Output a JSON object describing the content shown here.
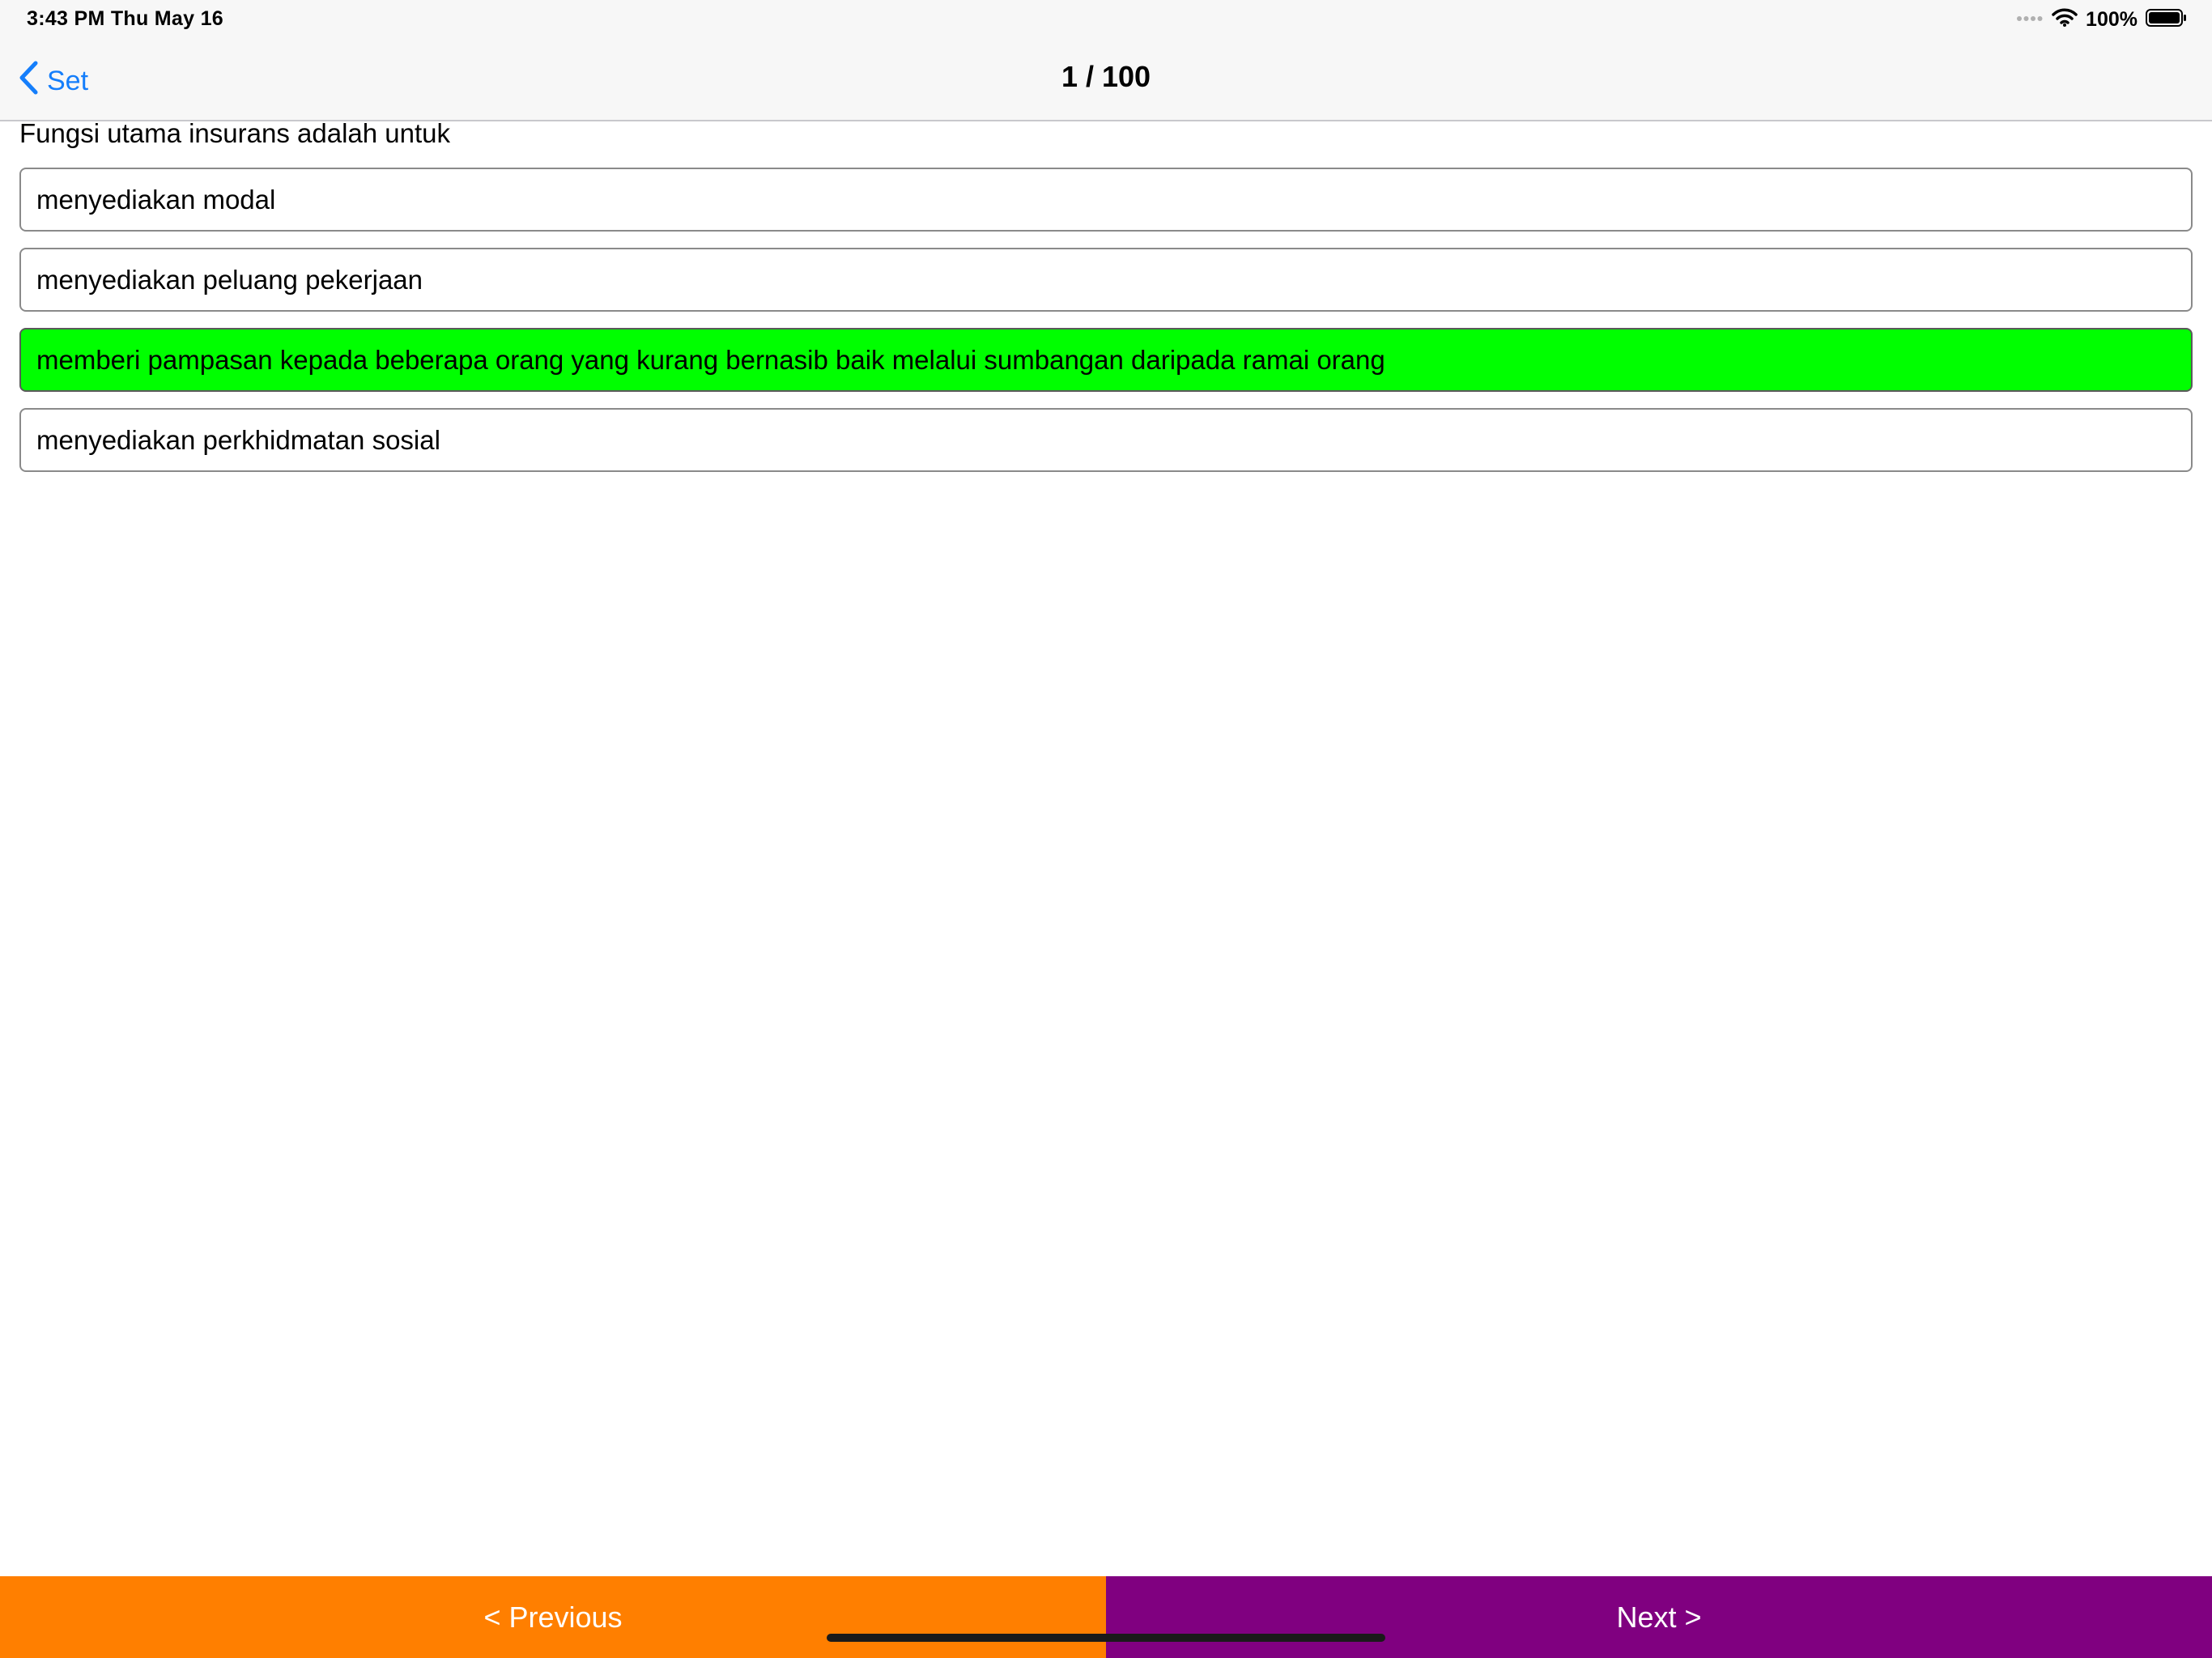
{
  "status_bar": {
    "time": "3:43 PM   Thu May 16",
    "battery": "100%",
    "icons": [
      "signal-dots-icon",
      "wifi-icon",
      "battery-icon"
    ]
  },
  "nav": {
    "back_label": "Set",
    "back_icon": "chevron-left-icon",
    "title": "1 / 100",
    "accent_color": "#157efb"
  },
  "question": {
    "text": "Fungsi utama insurans adalah untuk"
  },
  "answers": [
    {
      "text": "menyediakan modal",
      "state": "default"
    },
    {
      "text": "menyediakan peluang pekerjaan",
      "state": "default"
    },
    {
      "text": "memberi pampasan kepada beberapa orang yang kurang bernasib baik melalui sumbangan daripada ramai orang",
      "state": "correct"
    },
    {
      "text": "menyediakan perkhidmatan sosial",
      "state": "default"
    }
  ],
  "colors": {
    "correct": "#00ff00",
    "previous_button": "#ff7f00",
    "next_button": "#800080"
  },
  "footer": {
    "previous_label": "< Previous",
    "next_label": "Next >"
  }
}
